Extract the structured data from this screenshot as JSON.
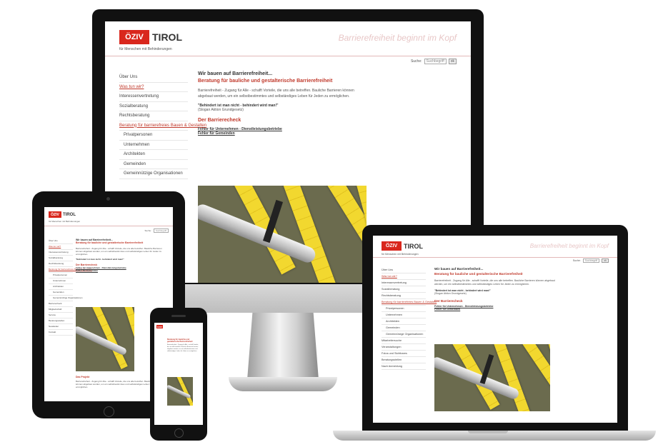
{
  "site": {
    "logo_box": "ÖZIV",
    "logo_word": "TIROL",
    "tagline": "für Menschen mit Behinderungen",
    "banner": "Barrierefreiheit beginnt im Kopf",
    "search_label": "Suche:",
    "search_placeholder": "Suchbegriff",
    "search_button": "ok",
    "nav": [
      {
        "label": "Über Uns",
        "style": "plain"
      },
      {
        "label": "Was tun wir?",
        "style": "red"
      },
      {
        "label": "Interessenvertretung",
        "style": "plain"
      },
      {
        "label": "Sozialberatung",
        "style": "plain"
      },
      {
        "label": "Rechtsberatung",
        "style": "plain"
      },
      {
        "label": "Beratung für barrierefreies Bauen & Gestalten",
        "style": "red"
      },
      {
        "label": "Privatpersonen",
        "style": "sub"
      },
      {
        "label": "Unternehmen",
        "style": "sub"
      },
      {
        "label": "Architekten",
        "style": "sub"
      },
      {
        "label": "Gemeinden",
        "style": "sub"
      },
      {
        "label": "Gemeinnützige Organisationen",
        "style": "sub"
      }
    ],
    "heading": "Wir bauen auf Barrierefreiheit...",
    "subheading": "Beratung für bauliche und gestalterische Barrierefreiheit",
    "paragraph": "Barrierefreiheit - Zugang für Alle - schafft Vorteile, die uns alle betreffen. Bauliche Barrieren können abgebaut werden, um ein selbstbestimmtes und selbständiges Leben für Jeden zu ermöglichen.",
    "quote": "\"Behindert ist man nicht - behindert wird man!\"",
    "quote_source": "(Slogan Aktion Grundgesetz)",
    "section_title": "Der Barrierecheck",
    "link1": "Fehler für Unternehmen - Dienstleistungsbetriebe",
    "link2": "Fehler für Gemeinden",
    "laptop_nav_extra": [
      "Mitarbeitersuche",
      "Veranstaltungen",
      "Fotos und Sichtbares",
      "Beratungsstellen",
      "Nach Anmeldung"
    ],
    "tablet_nav_extra": [
      "Barrierecheck",
      "Mitgliedschaft",
      "Service",
      "Beratungsstellen",
      "Newsletter",
      "Kontakt"
    ],
    "tablet_section2": "Das Projekt"
  }
}
